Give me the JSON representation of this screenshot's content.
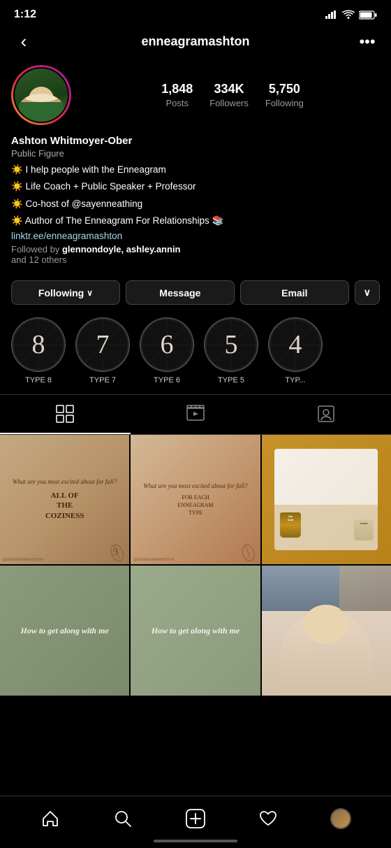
{
  "status": {
    "time": "1:12",
    "arrow_icon": "↗"
  },
  "header": {
    "back_label": "‹",
    "username": "enneagramashton",
    "more_label": "•••"
  },
  "profile": {
    "stats": [
      {
        "number": "1,848",
        "label": "Posts"
      },
      {
        "number": "334K",
        "label": "Followers"
      },
      {
        "number": "5,750",
        "label": "Following"
      }
    ],
    "name": "Ashton Whitmoyer-Ober",
    "category": "Public Figure",
    "bio_lines": [
      "☀️ I help people with the Enneagram",
      "☀️ Life Coach + Public Speaker + Professor",
      "☀️ Co-host of @sayenneathing",
      "☀️ Author of The Enneagram For Relationships 📚"
    ],
    "link": "linktr.ee/enneagramashton",
    "followed_by": "Followed by",
    "followers_names": "glennondoyle, ashley.annin",
    "and_others": "and 12 others"
  },
  "buttons": {
    "following": "Following",
    "following_chevron": "∨",
    "message": "Message",
    "email": "Email",
    "dropdown": "∨"
  },
  "highlights": [
    {
      "number": "8",
      "label": "TYPE 8"
    },
    {
      "number": "7",
      "label": "TYPE 7"
    },
    {
      "number": "6",
      "label": "TYPE 6"
    },
    {
      "number": "5",
      "label": "TYPE 5"
    },
    {
      "number": "4",
      "label": "TYP..."
    }
  ],
  "tabs": [
    {
      "icon": "grid",
      "active": true
    },
    {
      "icon": "tv",
      "active": false
    },
    {
      "icon": "person-tag",
      "active": false
    }
  ],
  "posts": [
    {
      "type": "fall1",
      "top_text": "What are you most excited about for fall?",
      "bottom_text": "ALL OF THE COZINESS",
      "handle": "@ENNEAGRAMASHTON"
    },
    {
      "type": "fall2",
      "top_text": "What are you most excited about for fall?",
      "sub_text": "FOR EACH ENNEAGRAM TYPE",
      "handle": "@ENNEAGRAMASHTON"
    },
    {
      "type": "product"
    },
    {
      "type": "howto1",
      "text": "How to get along with me"
    },
    {
      "type": "howto2",
      "text": "How to get along with me"
    },
    {
      "type": "person"
    }
  ],
  "nav": {
    "home_icon": "⌂",
    "search_icon": "⌕",
    "add_icon": "+",
    "heart_icon": "♡",
    "profile_icon": "avatar"
  }
}
